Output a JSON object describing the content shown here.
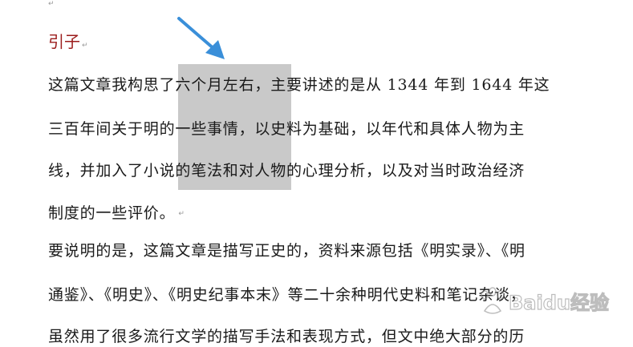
{
  "document": {
    "heading": "引子",
    "paragraph_mark": "↵",
    "lines": [
      "这篇文章我构思了六个月左右，主要讲述的是从 1344 年到 1644 年这",
      "三百年间关于明的一些事情，以史料为基础，以年代和具体人物为主",
      "线，并加入了小说的笔法和对人物的心理分析，以及对当时政治经济",
      "制度的一些评价。",
      "要说明的是，这篇文章是描写正史的，资料来源包括《明实录》、《明",
      "通鉴》、《明史》、《明史纪事本末》等二十余种明代史料和笔记杂谈，",
      "虽然用了很多流行文学的描写手法和表现方式，但文中绝大部分的历"
    ]
  },
  "annotations": {
    "arrow_color": "#3a8fd9",
    "arrow_icon": "arrow-pointer-icon",
    "selection_color": "#c9c9c9"
  },
  "watermark": {
    "text": "Baidu经验",
    "icon": "baidu-paw-icon"
  }
}
